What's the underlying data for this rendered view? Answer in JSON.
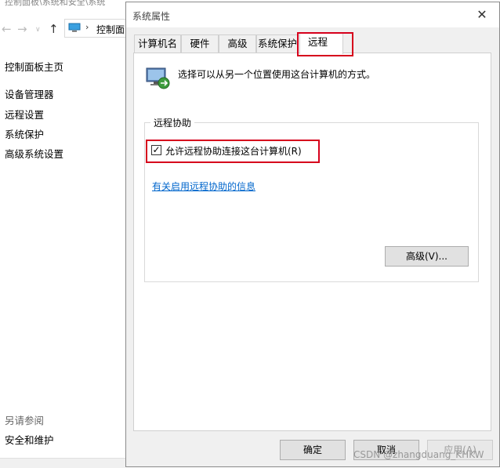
{
  "background_window": {
    "path_partial": "控制面板\\系统和安全\\系统",
    "address_text": "控制面",
    "sidebar": {
      "home": "控制面板主页",
      "items": [
        "设备管理器",
        "远程设置",
        "系统保护",
        "高级系统设置"
      ],
      "see_also_title": "另请参阅",
      "see_also_items": [
        "安全和维护"
      ]
    }
  },
  "dialog": {
    "title": "系统属性",
    "close_glyph": "✕",
    "tabs": [
      {
        "label": "计算机名"
      },
      {
        "label": "硬件"
      },
      {
        "label": "高级"
      },
      {
        "label": "系统保护"
      },
      {
        "label": "远程",
        "selected": true
      }
    ],
    "remote_tab": {
      "description": "选择可以从另一个位置使用这台计算机的方式。",
      "assistance_group_title": "远程协助",
      "allow_checkbox_label": "允许远程协助连接这台计算机(R)",
      "allow_checked": true,
      "info_link": "有关启用远程协助的信息",
      "advanced_button": "高级(V)..."
    },
    "buttons": {
      "ok": "确定",
      "cancel": "取消",
      "apply": "应用(A)"
    }
  },
  "watermark": "CSDN @zhangduang_KHKW",
  "colors": {
    "highlight": "#d6001c",
    "link": "#0066cc"
  }
}
